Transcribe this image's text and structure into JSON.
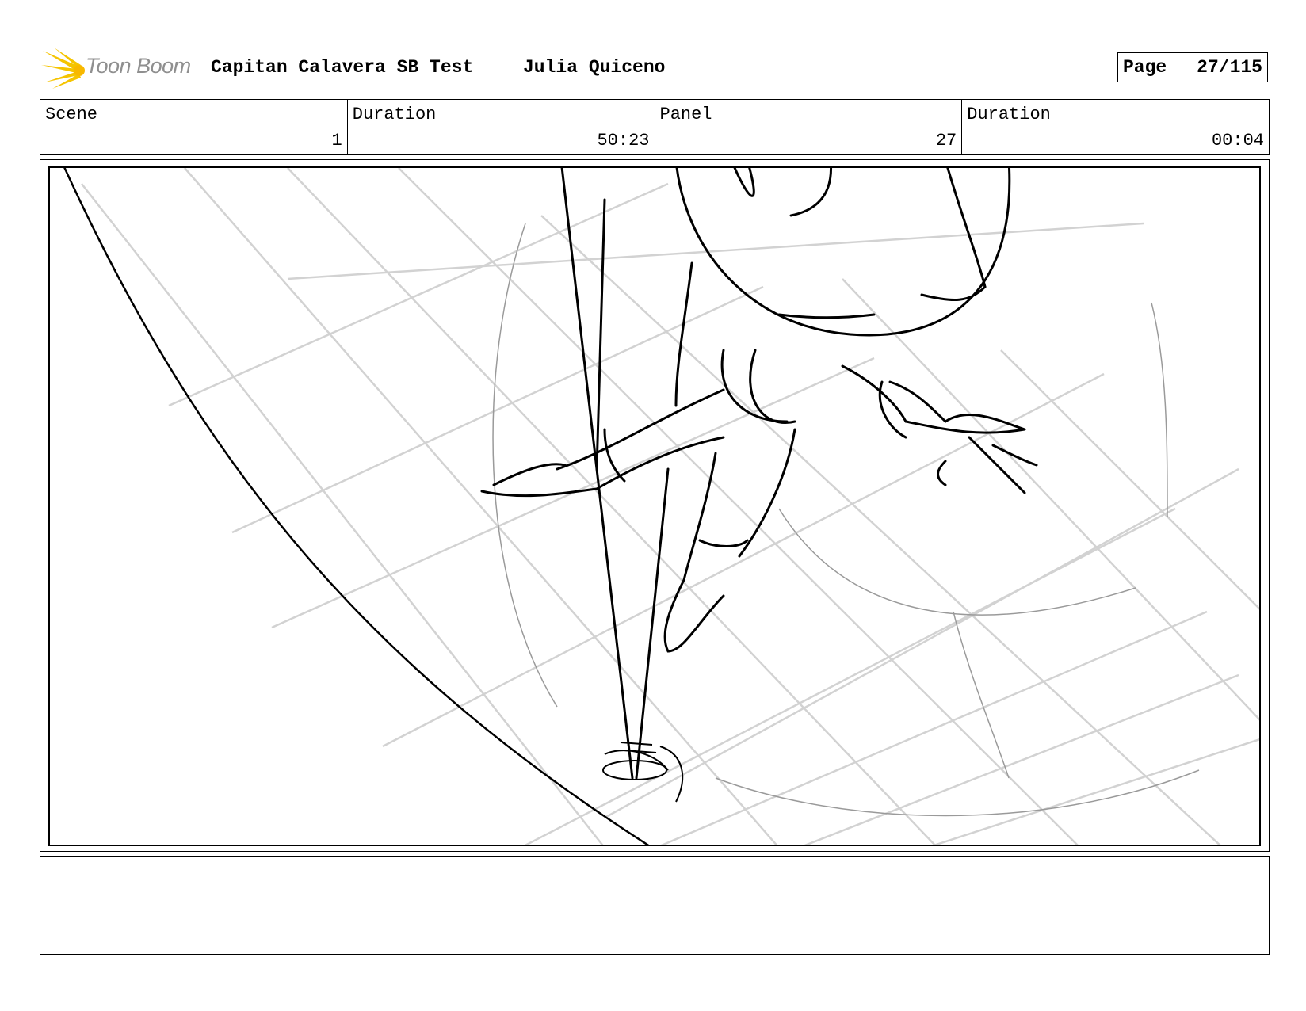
{
  "header": {
    "logo_text": "Toon Boom",
    "project_title": "Capitan Calavera SB Test",
    "author": "Julia Quiceno",
    "page_label": "Page",
    "page_number": "27/115"
  },
  "info": {
    "scene_label": "Scene",
    "scene_value": "1",
    "scene_duration_label": "Duration",
    "scene_duration_value": "50:23",
    "panel_label": "Panel",
    "panel_value": "27",
    "panel_duration_label": "Duration",
    "panel_duration_value": "00:04"
  },
  "colors": {
    "logo_flare": "#f5c400",
    "logo_text": "#8f8f8f",
    "grid_lines": "#cfcfcf",
    "ink": "#000000"
  }
}
